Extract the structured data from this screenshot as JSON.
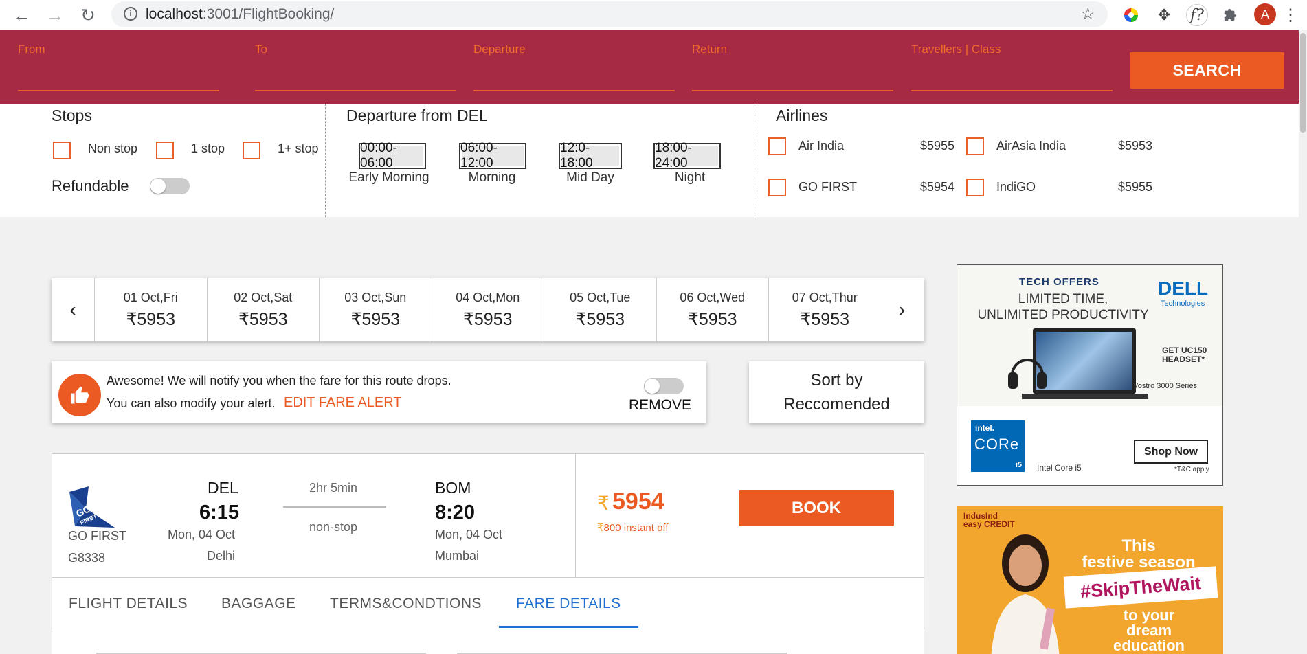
{
  "browser": {
    "url_host": "localhost",
    "url_path": ":3001/FlightBooking/",
    "avatar_letter": "A",
    "info_icon": "i"
  },
  "search": {
    "fields": [
      {
        "label": "From"
      },
      {
        "label": "To"
      },
      {
        "label": "Departure"
      },
      {
        "label": "Return"
      },
      {
        "label": "Travellers | Class"
      }
    ],
    "button_label": "SEARCH"
  },
  "filters": {
    "stops_title": "Stops",
    "stops": [
      "Non stop",
      "1 stop",
      "1+ stop"
    ],
    "refundable_label": "Refundable",
    "departure_title": "Departure from DEL",
    "time_slots": [
      {
        "range": "00:00-06:00",
        "label": "Early Morning"
      },
      {
        "range": "06:00-12:00",
        "label": "Morning"
      },
      {
        "range": "12:0-18:00",
        "label": "Mid Day"
      },
      {
        "range": "18:00-24:00",
        "label": "Night"
      }
    ],
    "airlines_title": "Airlines",
    "airlines": [
      {
        "name": "Air India",
        "price": "$5955"
      },
      {
        "name": "AirAsia India",
        "price": "$5953"
      },
      {
        "name": "GO FIRST",
        "price": "$5954"
      },
      {
        "name": "IndiGO",
        "price": "$5955"
      }
    ]
  },
  "dates": [
    {
      "date": "01 Oct,Fri",
      "price": "₹5953"
    },
    {
      "date": "02 Oct,Sat",
      "price": "₹5953"
    },
    {
      "date": "03 Oct,Sun",
      "price": "₹5953"
    },
    {
      "date": "04 Oct,Mon",
      "price": "₹5953"
    },
    {
      "date": "05 Oct,Tue",
      "price": "₹5953"
    },
    {
      "date": "06 Oct,Wed",
      "price": "₹5953"
    },
    {
      "date": "07 Oct,Thur",
      "price": "₹5953"
    }
  ],
  "fare_alert": {
    "line1": "Awesome! We will notify you when the fare for this route drops.",
    "line2": "You can also modify your alert.",
    "edit_label": "EDIT FARE ALERT",
    "remove_label": "REMOVE"
  },
  "sort": {
    "line1": "Sort by",
    "line2": "Reccomended"
  },
  "flight": {
    "airline": "GO FIRST",
    "flight_no": "G8338",
    "logo_text": "GO FIRST",
    "from_code": "DEL",
    "dep_time": "6:15",
    "dep_date": "Mon, 04 Oct",
    "from_city": "Delhi",
    "duration": "2hr 5min",
    "stops": "non-stop",
    "to_code": "BOM",
    "arr_time": "8:20",
    "arr_date": "Mon, 04 Oct",
    "to_city": "Mumbai",
    "currency": "₹",
    "price": "5954",
    "instant_off": "800 instant off",
    "book_label": "BOOK"
  },
  "tabs": [
    "FLIGHT DETAILS",
    "BAGGAGE",
    "TERMS&CONDTIONS",
    "FARE DETAILS"
  ],
  "active_tab": "FARE DETAILS",
  "ads": {
    "dell": {
      "tech_offers": "TECH OFFERS",
      "headline_1": "LIMITED TIME,",
      "headline_2": "UNLIMITED PRODUCTIVITY",
      "brand": "DELL",
      "brand_sub": "Technologies",
      "headset_1": "GET UC150",
      "headset_2": "HEADSET*",
      "model": "Vostro 3000 Series",
      "intel": "intel.",
      "core": "CORe",
      "i5": "i5",
      "cpu": "Intel Core i5",
      "cta": "Shop Now",
      "tc": "*T&C apply"
    },
    "indus": {
      "brand_1": "IndusInd",
      "brand_2": "easy CREDIT",
      "headline_1": "This",
      "headline_2": "festive season",
      "hashtag": "#SkipTheWait",
      "tail_1": "to your",
      "tail_2": "dream",
      "tail_3": "education"
    }
  },
  "colors": {
    "header_bg": "#a62a43",
    "accent": "#ea5a22",
    "tab_active": "#1e6fd0"
  }
}
